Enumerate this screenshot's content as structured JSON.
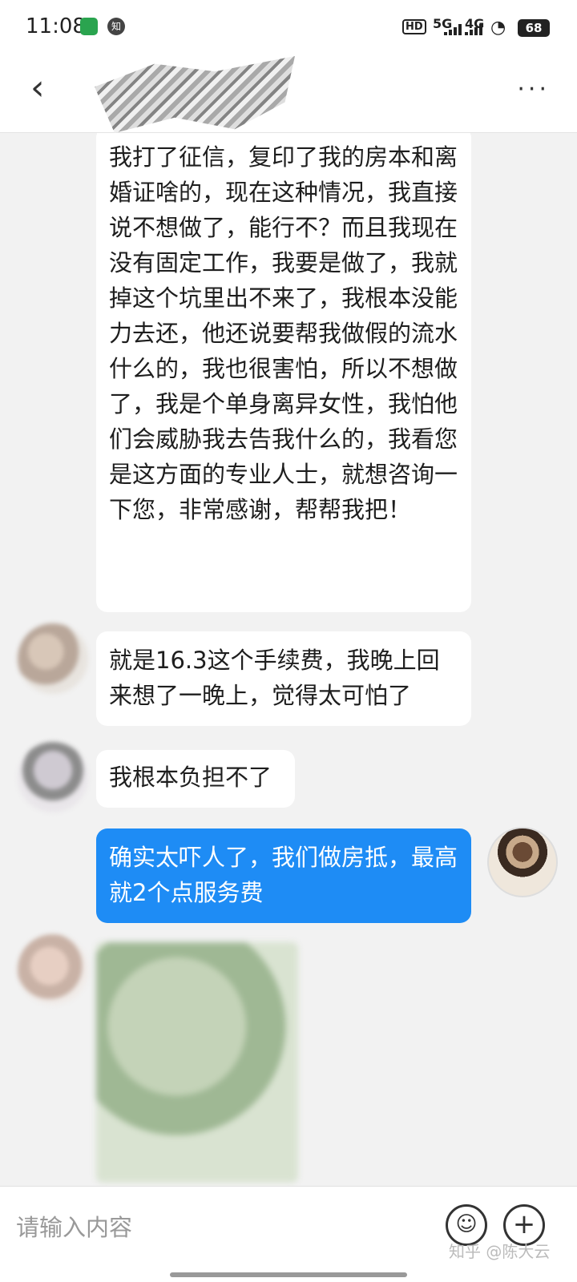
{
  "status_bar": {
    "time": "11:08",
    "app_badge": "知",
    "hd": "HD",
    "net1": "5G",
    "net2": "4G",
    "battery": "68"
  },
  "nav": {
    "back_icon": "chevron-left-icon",
    "more_icon": "more-icon",
    "more_label": "···"
  },
  "messages": [
    {
      "from": "them",
      "text": "我打了征信，复印了我的房本和离婚证啥的，现在这种情况，我直接说不想做了，能行不？而且我现在没有固定工作，我要是做了，我就掉这个坑里出不来了，我根本没能力去还，他还说要帮我做假的流水什么的，我也很害怕，所以不想做了，我是个单身离异女性，我怕他们会威胁我去告我什么的，我看您是这方面的专业人士，就想咨询一下您，非常感谢，帮帮我把！"
    },
    {
      "from": "them",
      "text": "就是16.3这个手续费，我晚上回来想了一晚上，觉得太可怕了"
    },
    {
      "from": "them",
      "text": "我根本负担不了"
    },
    {
      "from": "me",
      "text": "确实太吓人了，我们做房抵，最高就2个点服务费"
    }
  ],
  "input": {
    "placeholder": "请输入内容",
    "emoji_icon": "emoji-icon",
    "plus_icon": "plus-icon",
    "emoji_label": "☺",
    "plus_label": "+"
  },
  "watermark": "知乎 @陈大云",
  "colors": {
    "my_bubble": "#1e8cf5",
    "their_bubble": "#ffffff",
    "background": "#f2f2f2"
  }
}
